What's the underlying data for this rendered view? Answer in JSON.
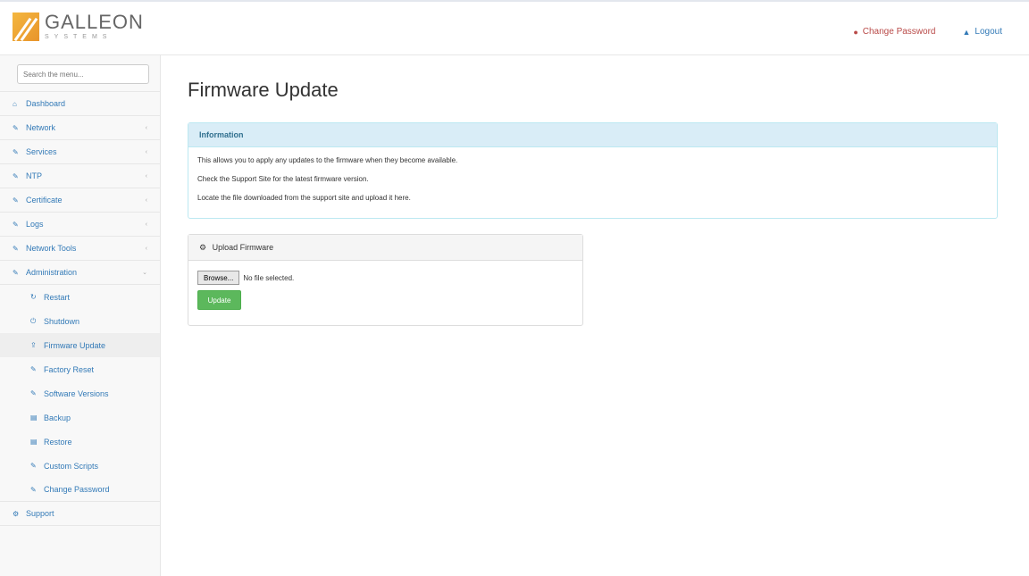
{
  "brand": {
    "name": "GALLEON",
    "subtitle": "SYSTEMS"
  },
  "header": {
    "change_password": "Change Password",
    "logout": "Logout"
  },
  "sidebar": {
    "search_placeholder": "Search the menu...",
    "items": [
      {
        "label": "Dashboard",
        "icon": "home-icon"
      },
      {
        "label": "Network",
        "icon": "wrench-icon",
        "expandable": true
      },
      {
        "label": "Services",
        "icon": "wrench-icon",
        "expandable": true
      },
      {
        "label": "NTP",
        "icon": "wrench-icon",
        "expandable": true
      },
      {
        "label": "Certificate",
        "icon": "wrench-icon",
        "expandable": true
      },
      {
        "label": "Logs",
        "icon": "wrench-icon",
        "expandable": true
      },
      {
        "label": "Network Tools",
        "icon": "wrench-icon",
        "expandable": true
      },
      {
        "label": "Administration",
        "icon": "wrench-icon",
        "expandable": true,
        "expanded": true
      }
    ],
    "admin_subitems": [
      {
        "label": "Restart",
        "icon": "refresh-icon"
      },
      {
        "label": "Shutdown",
        "icon": "power-icon"
      },
      {
        "label": "Firmware Update",
        "icon": "upload-icon",
        "active": true
      },
      {
        "label": "Factory Reset",
        "icon": "wrench-icon"
      },
      {
        "label": "Software Versions",
        "icon": "wrench-icon"
      },
      {
        "label": "Backup",
        "icon": "file-icon"
      },
      {
        "label": "Restore",
        "icon": "file-icon"
      },
      {
        "label": "Custom Scripts",
        "icon": "wrench-icon"
      },
      {
        "label": "Change Password",
        "icon": "wrench-icon"
      }
    ],
    "support": {
      "label": "Support",
      "icon": "gear-icon"
    }
  },
  "main": {
    "title": "Firmware Update",
    "info": {
      "heading": "Information",
      "lines": [
        "This allows you to apply any updates to the firmware when they become available.",
        "Check the Support Site for the latest firmware version.",
        "Locate the file downloaded from the support site and upload it here."
      ]
    },
    "upload": {
      "heading": "Upload Firmware",
      "browse_label": "Browse...",
      "no_file_text": "No file selected.",
      "update_label": "Update"
    }
  },
  "colors": {
    "link": "#337ab7",
    "danger": "#b94a48",
    "info_bg": "#d9edf7",
    "success": "#5cb85c"
  }
}
